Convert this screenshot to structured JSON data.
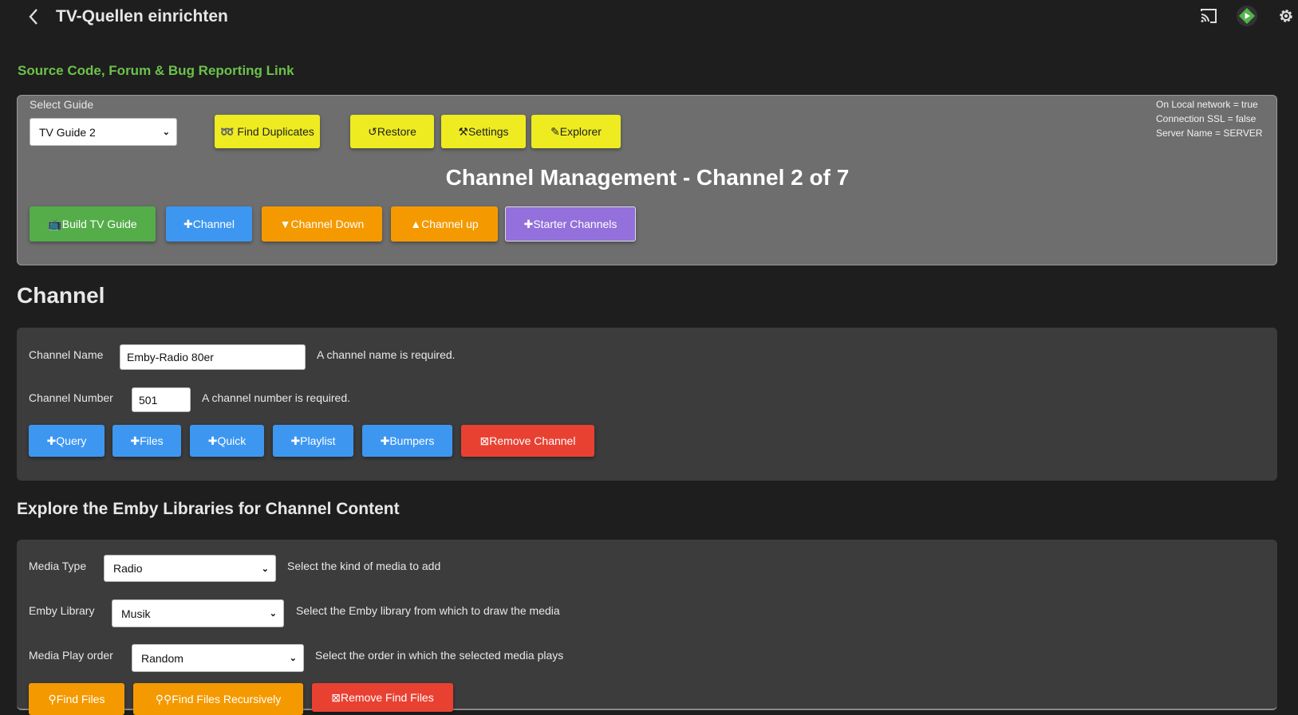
{
  "header": {
    "title": "TV-Quellen einrichten",
    "back_icon": "chevron-left-icon",
    "cast_icon": "cast-icon",
    "play_icon": "emby-play-icon",
    "settings_icon": "gear-icon"
  },
  "link": "Source Code, Forum & Bug Reporting Link",
  "top_panel": {
    "select_label": "Select Guide",
    "select_value": "TV Guide 2",
    "status": [
      "On Local network = true",
      "Connection SSL = false",
      "Server Name = SERVER"
    ],
    "tools": [
      "➿ Find Duplicates",
      "↺Restore",
      "⚒Settings",
      "✎Explorer"
    ],
    "heading": "Channel Management - Channel 2 of 7",
    "actions": [
      "📺Build TV Guide",
      "✚Channel",
      "▼Channel Down",
      "▲Channel up",
      "✚Starter Channels"
    ]
  },
  "channel": {
    "heading": "Channel",
    "name_label": "Channel Name",
    "name_value": "Emby-Radio 80er",
    "name_hint": "A channel name is required.",
    "number_label": "Channel Number",
    "number_value": "501",
    "number_hint": "A channel number is required.",
    "buttons": [
      "✚Query",
      "✚Files",
      "✚Quick",
      "✚Playlist",
      "✚Bumpers",
      "⊠Remove Channel"
    ]
  },
  "explore": {
    "heading": "Explore the Emby Libraries for Channel Content",
    "media_type_label": "Media Type",
    "media_type_value": "Radio",
    "media_type_hint": "Select the kind of media to add",
    "library_label": "Emby Library",
    "library_value": "Musik",
    "library_hint": "Select the Emby library from which to draw the media",
    "order_label": "Media Play order",
    "order_value": "Random",
    "order_hint": "Select the order in which the selected media plays",
    "buttons": [
      "⚲Find Files",
      "⚲⚲Find Files Recursively",
      "⊠Remove Find Files"
    ]
  },
  "colors": {
    "link": "#6cc24a",
    "yellow": "#eeeb21",
    "green": "#55ad4a",
    "blue": "#3d97f1",
    "orange": "#f49a00",
    "purple": "#9370db",
    "red": "#e84132"
  }
}
